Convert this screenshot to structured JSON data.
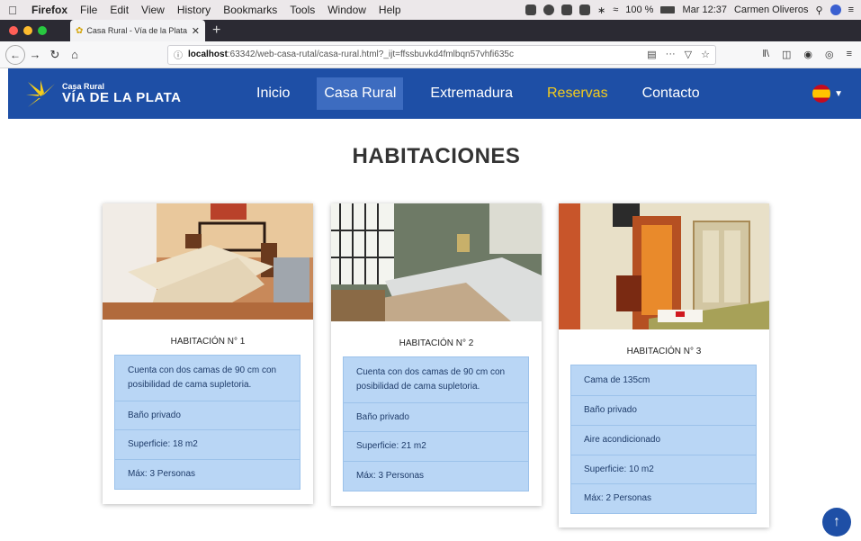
{
  "menubar": {
    "app": "Firefox",
    "items": [
      "File",
      "Edit",
      "View",
      "History",
      "Bookmarks",
      "Tools",
      "Window",
      "Help"
    ],
    "battery": "100 %",
    "clock": "Mar 12:37",
    "user": "Carmen Oliveros"
  },
  "browser": {
    "tab_title": "Casa Rural - Vía de la Plata - C",
    "url_host": "localhost",
    "url_rest": ":63342/web-casa-rutal/casa-rural.html?_ijt=ffssbuvkd4fmlbqn57vhfi635c"
  },
  "site": {
    "logo_small": "Casa Rural",
    "logo_big": "VÍA DE LA PLATA",
    "menu": [
      "Inicio",
      "Casa Rural",
      "Extremadura",
      "Reservas",
      "Contacto"
    ],
    "brand_color": "#1e4fa6",
    "highlight_color": "#f4cc1c"
  },
  "page": {
    "title": "HABITACIONES"
  },
  "rooms": [
    {
      "title": "HABITACIÓN N° 1",
      "features": [
        "Cuenta con dos camas de 90 cm con posibilidad de cama supletoria.",
        "Baño privado",
        "Superficie: 18 m2",
        "Máx: 3 Personas"
      ]
    },
    {
      "title": "HABITACIÓN N° 2",
      "features": [
        "Cuenta con dos camas de 90 cm con posibilidad de cama supletoria.",
        "Baño privado",
        "Superficie: 21 m2",
        "Máx: 3 Personas"
      ]
    },
    {
      "title": "HABITACIÓN N° 3",
      "features": [
        "Cama de 135cm",
        "Baño privado",
        "Aire acondicionado",
        "Superficie: 10 m2",
        "Máx: 2 Personas"
      ]
    }
  ]
}
